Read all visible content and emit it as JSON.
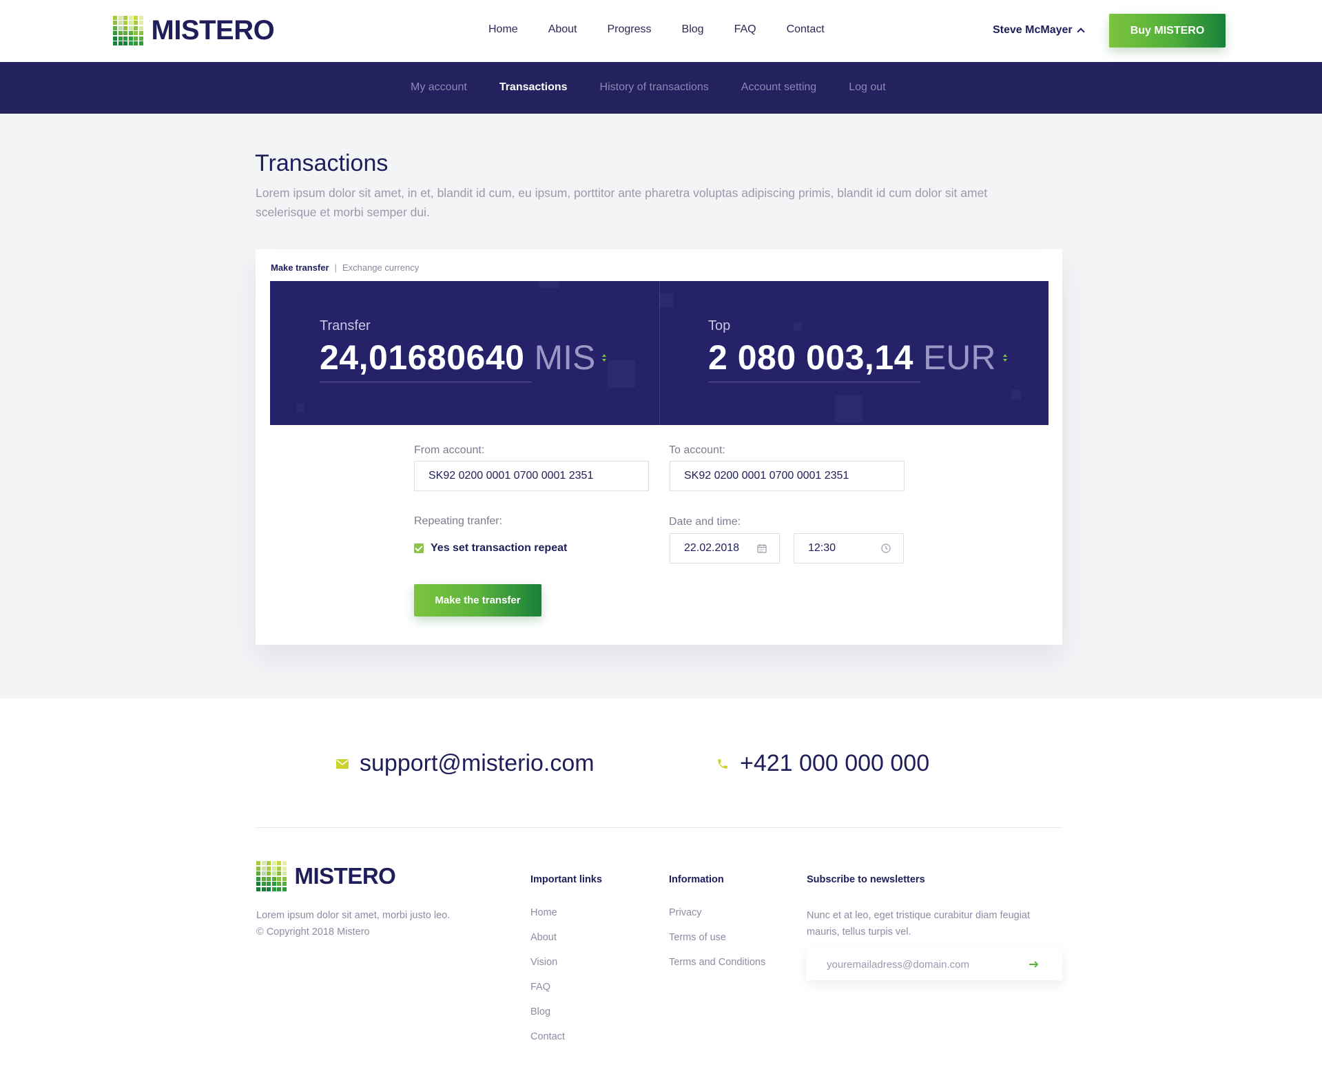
{
  "brand": {
    "name": "MISTERO"
  },
  "nav": {
    "items": [
      "Home",
      "About",
      "Progress",
      "Blog",
      "FAQ",
      "Contact"
    ],
    "user": "Steve McMayer",
    "buy_label": "Buy MISTERO"
  },
  "subnav": {
    "items": [
      "My account",
      "Transactions",
      "History of transactions",
      "Account setting",
      "Log out"
    ],
    "active": "Transactions"
  },
  "page": {
    "title": "Transactions",
    "description": "Lorem ipsum dolor sit amet, in et, blandit id cum, eu ipsum, porttitor ante pharetra voluptas adipiscing primis, blandit id cum dolor sit amet scelerisque et morbi semper dui."
  },
  "card": {
    "tab_active": "Make transfer",
    "tab_separator": "|",
    "tab_other": "Exchange currency",
    "transfer": {
      "label": "Transfer",
      "value": "24,01680640",
      "currency": "MIS"
    },
    "top": {
      "label": "Top",
      "value": "2 080 003,14",
      "currency": "EUR"
    },
    "from_label": "From account:",
    "from_value": "SK92 0200 0001 0700 0001 2351",
    "to_label": "To account:",
    "to_value": "SK92 0200 0001 0700 0001 2351",
    "repeat_label": "Repeating tranfer:",
    "repeat_checkbox": "Yes set transaction repeat",
    "datetime_label": "Date and time:",
    "date_value": "22.02.2018",
    "time_value": "12:30",
    "submit_label": "Make the transfer"
  },
  "footer": {
    "email": "support@misterio.com",
    "phone": "+421 000 000 000",
    "about_line1": "Lorem ipsum dolor sit amet, morbi justo leo.",
    "about_line2": "© Copyright 2018 Mistero",
    "links_title": "Important links",
    "links": [
      "Home",
      "About",
      "Vision",
      "FAQ",
      "Blog",
      "Contact"
    ],
    "info_title": "Information",
    "info": [
      "Privacy",
      "Terms of use",
      "Terms and Conditions"
    ],
    "newsletter_title": "Subscribe to newsletters",
    "newsletter_text": "Nunc et at leo, eget tristique curabitur diam feugiat mauris, tellus turpis vel.",
    "newsletter_placeholder": "youremailadress@domain.com"
  },
  "colors": {
    "navy": "#23215e",
    "panel": "#25226a",
    "green": "#7dc43e",
    "dark_green": "#17803b"
  },
  "icons": [
    "logo-icon",
    "chevron-up-icon",
    "calendar-icon",
    "clock-icon",
    "sort-arrows-icon",
    "checkbox-checked-icon",
    "envelope-icon",
    "phone-icon",
    "arrow-right-icon"
  ]
}
